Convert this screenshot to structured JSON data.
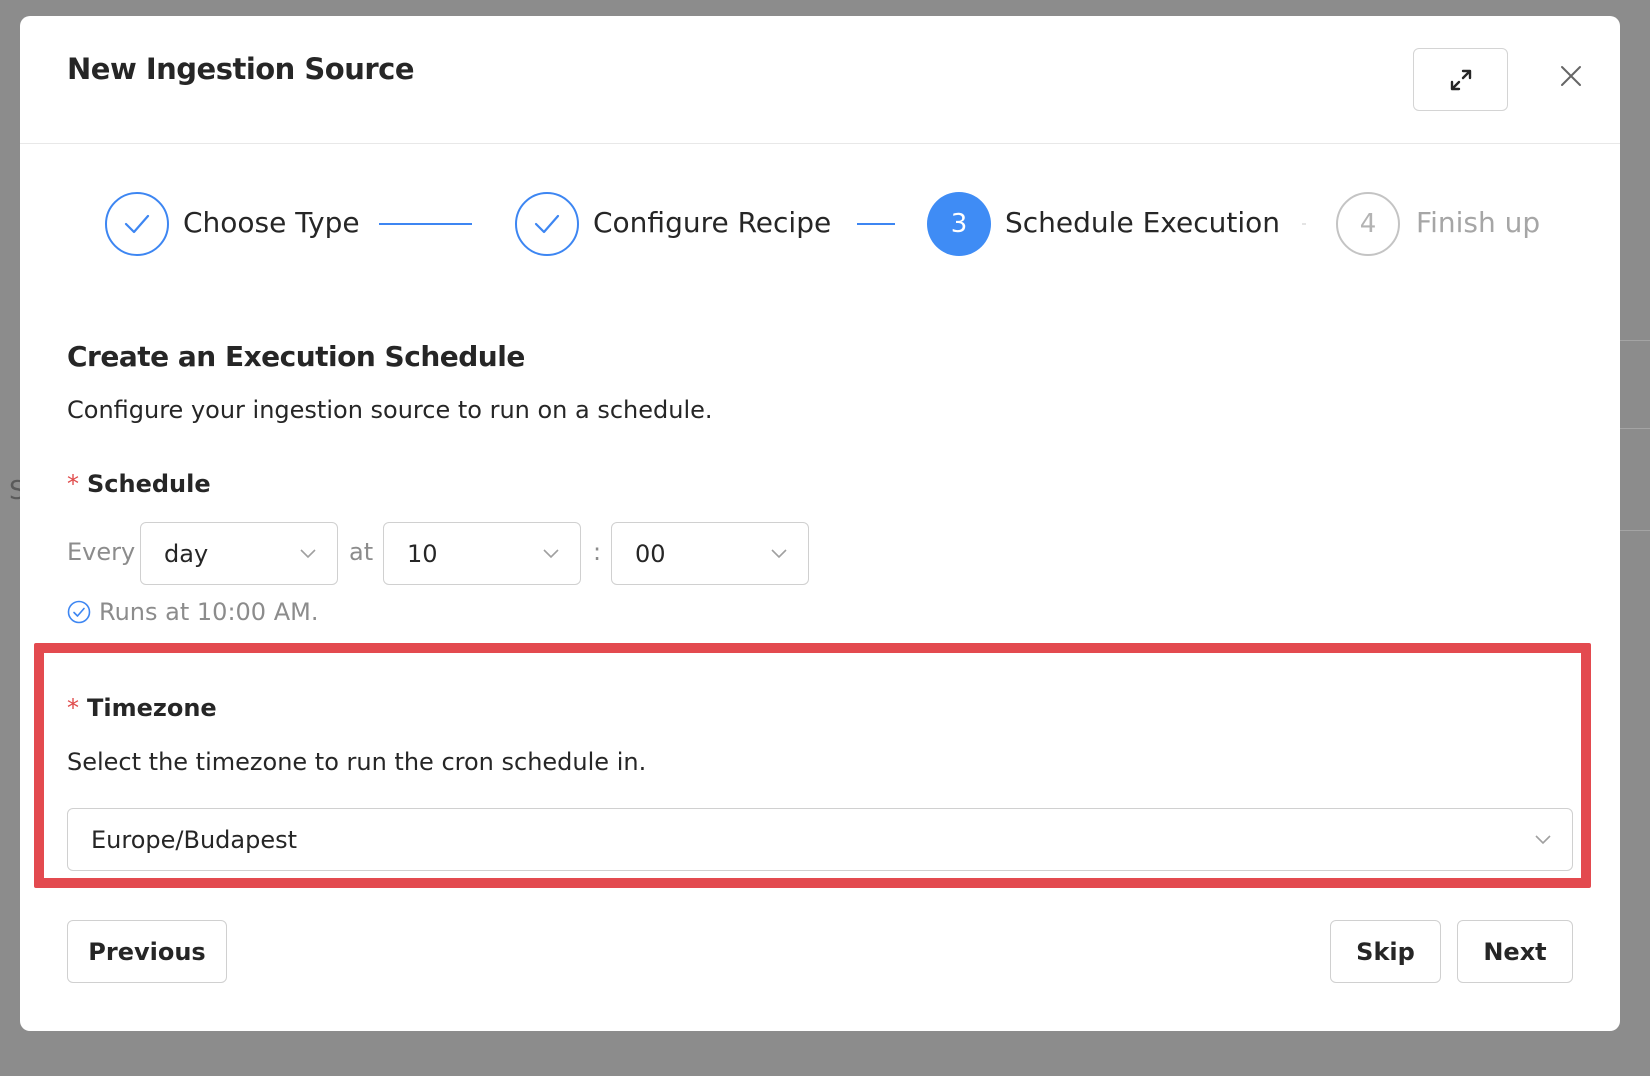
{
  "modal": {
    "title": "New Ingestion Source"
  },
  "steps": [
    {
      "label": "Choose Type",
      "status": "done"
    },
    {
      "label": "Configure Recipe",
      "status": "done"
    },
    {
      "number": "3",
      "label": "Schedule Execution",
      "status": "active"
    },
    {
      "number": "4",
      "label": "Finish up",
      "status": "wait"
    }
  ],
  "section": {
    "title": "Create an Execution Schedule",
    "description": "Configure your ingestion source to run on a schedule."
  },
  "schedule": {
    "required_mark": "*",
    "label": "Schedule",
    "every_text": "Every",
    "interval": "day",
    "at_text": "at",
    "hour": "10",
    "separator": ":",
    "minute": "00",
    "summary": "Runs at 10:00 AM."
  },
  "timezone": {
    "required_mark": "*",
    "label": "Timezone",
    "description": "Select the timezone to run the cron schedule in.",
    "value": "Europe/Budapest"
  },
  "buttons": {
    "previous": "Previous",
    "skip": "Skip",
    "next": "Next"
  },
  "colors": {
    "primary": "#3f8cf5",
    "required": "#e04b4b",
    "highlight": "#e34a4f"
  }
}
